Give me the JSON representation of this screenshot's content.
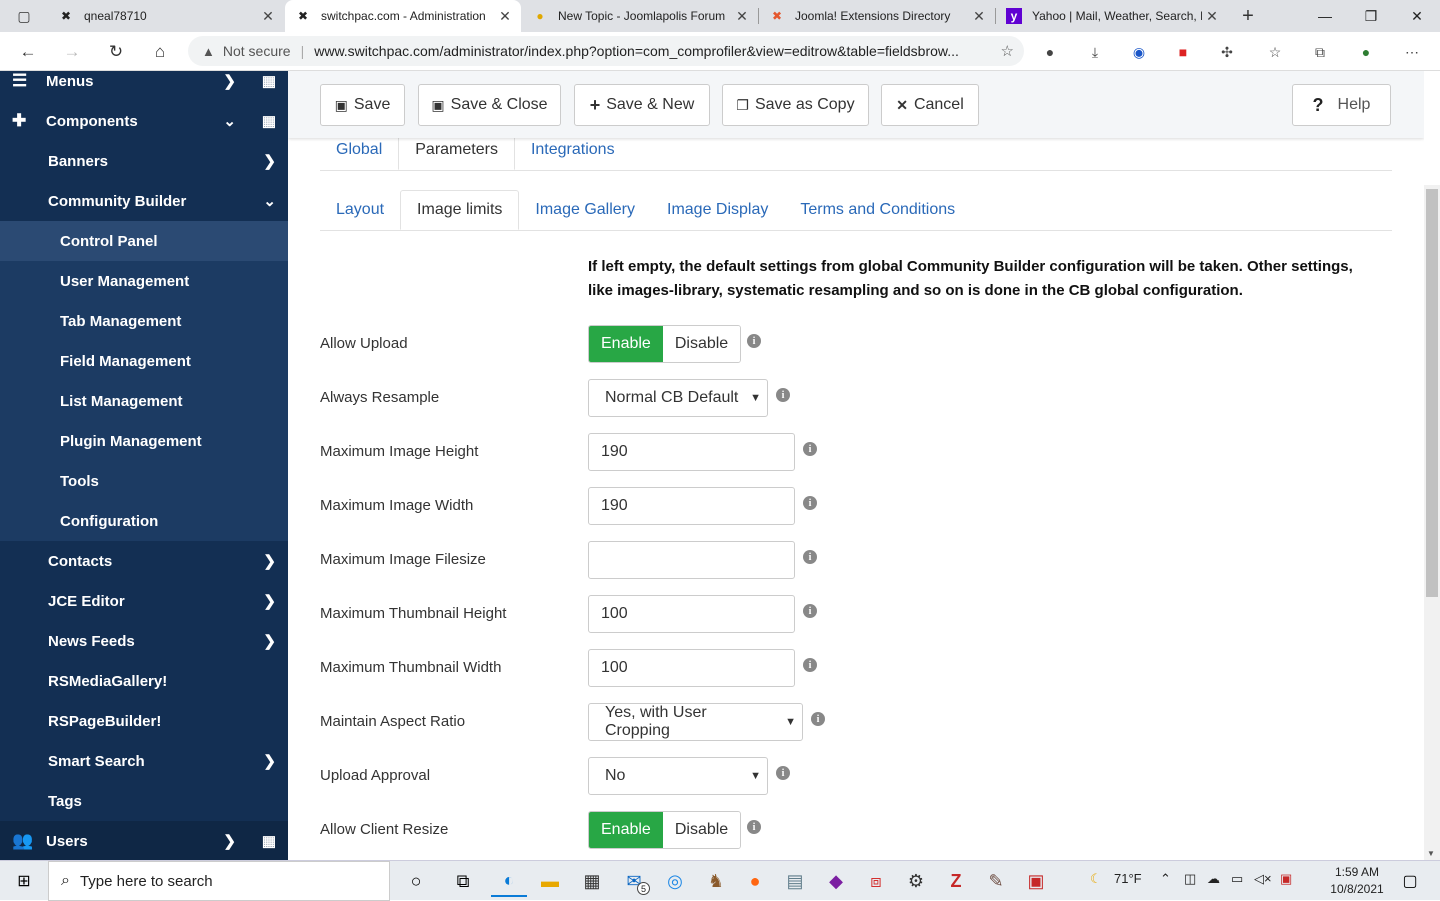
{
  "browser": {
    "tabs": [
      {
        "title": "qneal78710",
        "icon": "joomla-icon",
        "active": false
      },
      {
        "title": "switchpac.com - Administration",
        "icon": "joomla-icon",
        "active": true
      },
      {
        "title": "New Topic - Joomlapolis Forum",
        "icon": "joomlapolis-icon",
        "active": false
      },
      {
        "title": "Joomla! Extensions Directory",
        "icon": "joomla-icon",
        "active": false
      },
      {
        "title": "Yahoo | Mail, Weather, Search, P",
        "icon": "yahoo-icon",
        "active": false
      }
    ],
    "security": "Not secure",
    "url": "www.switchpac.com/administrator/index.php?option=com_comprofiler&view=editrow&table=fieldsbrow..."
  },
  "sidebar": {
    "items": [
      {
        "label": "Menus",
        "level": "top",
        "icon": "list-icon",
        "chevron": "right",
        "grid": true
      },
      {
        "label": "Components",
        "level": "top",
        "icon": "puzzle-icon",
        "chevron": "down",
        "grid": true
      },
      {
        "label": "Banners",
        "level": "l1",
        "chevron": "right"
      },
      {
        "label": "Community Builder",
        "level": "l1",
        "chevron": "down"
      },
      {
        "label": "Control Panel",
        "level": "l2",
        "active": true
      },
      {
        "label": "User Management",
        "level": "l2"
      },
      {
        "label": "Tab Management",
        "level": "l2"
      },
      {
        "label": "Field Management",
        "level": "l2"
      },
      {
        "label": "List Management",
        "level": "l2"
      },
      {
        "label": "Plugin Management",
        "level": "l2"
      },
      {
        "label": "Tools",
        "level": "l2"
      },
      {
        "label": "Configuration",
        "level": "l2"
      },
      {
        "label": "Contacts",
        "level": "l1",
        "chevron": "right"
      },
      {
        "label": "JCE Editor",
        "level": "l1",
        "chevron": "right"
      },
      {
        "label": "News Feeds",
        "level": "l1",
        "chevron": "right"
      },
      {
        "label": "RSMediaGallery!",
        "level": "l1"
      },
      {
        "label": "RSPageBuilder!",
        "level": "l1"
      },
      {
        "label": "Smart Search",
        "level": "l1",
        "chevron": "right"
      },
      {
        "label": "Tags",
        "level": "l1"
      },
      {
        "label": "Users",
        "level": "top",
        "icon": "users-icon",
        "chevron": "right",
        "grid": true
      }
    ]
  },
  "toolbar": {
    "save": "Save",
    "save_close": "Save & Close",
    "save_new": "Save & New",
    "save_copy": "Save as Copy",
    "cancel": "Cancel",
    "help": "Help"
  },
  "tabs": {
    "primary": [
      "Global",
      "Parameters",
      "Integrations"
    ],
    "primary_active": "Parameters",
    "secondary": [
      "Layout",
      "Image limits",
      "Image Gallery",
      "Image Display",
      "Terms and Conditions"
    ],
    "secondary_active": "Image limits"
  },
  "notice": "If left empty, the default settings from global Community Builder configuration will be taken. Other settings, like images-library, systematic resampling and so on is done in the CB global configuration.",
  "fields": {
    "allow_upload": {
      "label": "Allow Upload",
      "on": "Enable",
      "off": "Disable",
      "value": "Enable"
    },
    "always_resample": {
      "label": "Always Resample",
      "value": "Normal CB Default"
    },
    "max_height": {
      "label": "Maximum Image Height",
      "value": "190"
    },
    "max_width": {
      "label": "Maximum Image Width",
      "value": "190"
    },
    "max_filesize": {
      "label": "Maximum Image Filesize",
      "value": ""
    },
    "max_thumb_height": {
      "label": "Maximum Thumbnail Height",
      "value": "100"
    },
    "max_thumb_width": {
      "label": "Maximum Thumbnail Width",
      "value": "100"
    },
    "aspect_ratio": {
      "label": "Maintain Aspect Ratio",
      "value": "Yes, with User Cropping"
    },
    "upload_approval": {
      "label": "Upload Approval",
      "value": "No"
    },
    "client_resize": {
      "label": "Allow Client Resize",
      "on": "Enable",
      "off": "Disable",
      "value": "Enable"
    }
  },
  "taskbar": {
    "search_placeholder": "Type here to search",
    "mail_badge": "5",
    "weather": "71°F",
    "time": "1:59 AM",
    "date": "10/8/2021"
  },
  "colors": {
    "sidebar_bg": "#132f53",
    "enable_green": "#28a745",
    "link_blue": "#2a69b8"
  }
}
